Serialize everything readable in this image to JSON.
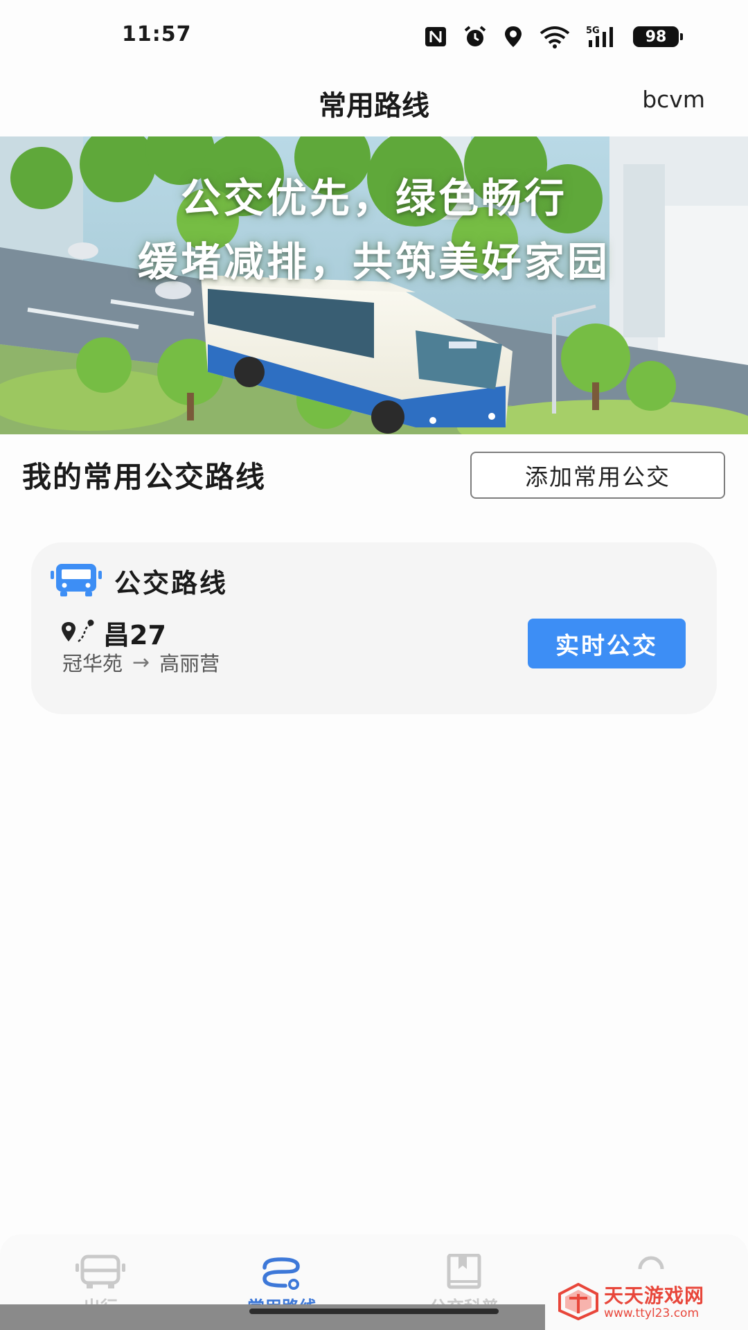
{
  "status_bar": {
    "time": "11:57",
    "icons": [
      "nfc-icon",
      "alarm-icon",
      "location-icon",
      "wifi-icon",
      "signal-5g-icon"
    ],
    "network": "5G",
    "battery": "98"
  },
  "header": {
    "title": "常用路线",
    "user": "bcvm"
  },
  "banner": {
    "line1": "公交优先，绿色畅行",
    "line2": "缓堵减排，共筑美好家园"
  },
  "section": {
    "title": "我的常用公交路线",
    "add_button": "添加常用公交"
  },
  "card": {
    "title": "公交路线",
    "route_number": "昌27",
    "from": "冠华苑",
    "arrow": "→",
    "to": "高丽营",
    "realtime_button": "实时公交"
  },
  "bottom_nav": {
    "items": [
      {
        "label": "出行",
        "icon": "bus-icon",
        "active": false
      },
      {
        "label": "常用路线",
        "icon": "route-icon",
        "active": true
      },
      {
        "label": "公交科普",
        "icon": "book-icon",
        "active": false
      },
      {
        "label": "",
        "icon": "profile-icon",
        "active": false
      }
    ]
  },
  "watermark": {
    "name": "天天游戏网",
    "url": "www.ttyl23.com"
  },
  "colors": {
    "accent": "#3d8ef5",
    "nav_active": "#3d78d8",
    "card_bg": "#f5f5f5",
    "watermark": "#e8463a"
  }
}
